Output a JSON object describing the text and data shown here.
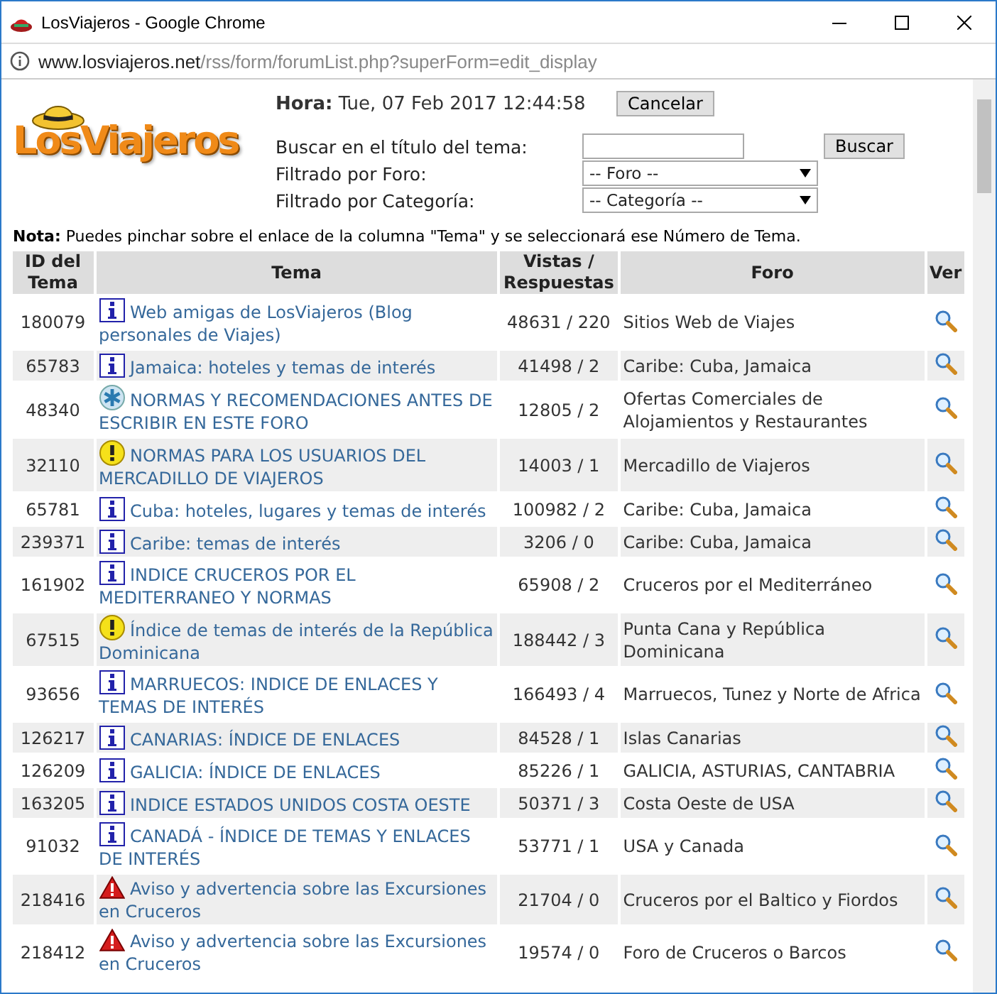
{
  "window": {
    "title": "LosViajeros - Google Chrome"
  },
  "address_bar": {
    "domain": "www.losviajeros.net",
    "path": "/rss/form/forumList.php?superForm=edit_display"
  },
  "logo": {
    "text": "LosViajeros"
  },
  "time": {
    "label": "Hora:",
    "value": "Tue, 07 Feb 2017 12:44:58"
  },
  "cancel_button": "Cancelar",
  "search": {
    "label": "Buscar en el título del tema:",
    "button": "Buscar"
  },
  "filters": [
    {
      "label": "Filtrado por Foro:",
      "value": "-- Foro --"
    },
    {
      "label": "Filtrado por Categoría:",
      "value": "-- Categoría --"
    }
  ],
  "note": "**Nota:** Puedes pinchar sobre el enlace de la columna \"Tema\" y se seleccionará ese Número de Tema.",
  "table": {
    "columns": [
      "ID del Tema",
      "Tema",
      "Vistas / Respuestas",
      "Foro",
      "Ver"
    ],
    "rows": [
      {
        "id": "180079",
        "kind": "info",
        "topic": "Web amigas de LosViajeros (Blog personales de Viajes)",
        "views": "48631 / 220",
        "forum": "Sitios Web de Viajes"
      },
      {
        "id": "65783",
        "kind": "info",
        "topic": "Jamaica: hoteles y temas de interés",
        "views": "41498 / 2",
        "forum": "Caribe: Cuba, Jamaica"
      },
      {
        "id": "48340",
        "kind": "asterisk",
        "topic": "NORMAS Y RECOMENDACIONES ANTES DE ESCRIBIR EN ESTE FORO",
        "views": "12805 / 2",
        "forum": "Ofertas Comerciales de Alojamientos y Restaurantes"
      },
      {
        "id": "32110",
        "kind": "notice",
        "topic": "NORMAS PARA LOS USUARIOS DEL MERCADILLO DE VIAJEROS",
        "views": "14003 / 1",
        "forum": "Mercadillo de Viajeros"
      },
      {
        "id": "65781",
        "kind": "info",
        "topic": "Cuba: hoteles, lugares y temas de interés",
        "views": "100982 / 2",
        "forum": "Caribe: Cuba, Jamaica"
      },
      {
        "id": "239371",
        "kind": "info",
        "topic": "Caribe: temas de interés",
        "views": "3206 / 0",
        "forum": "Caribe: Cuba, Jamaica"
      },
      {
        "id": "161902",
        "kind": "info",
        "topic": "INDICE CRUCEROS POR EL MEDITERRANEO Y NORMAS",
        "views": "65908 / 2",
        "forum": "Cruceros por el Mediterráneo"
      },
      {
        "id": "67515",
        "kind": "notice",
        "topic": "Índice de temas de interés de la República Dominicana",
        "views": "188442 / 3",
        "forum": "Punta Cana y República Dominicana"
      },
      {
        "id": "93656",
        "kind": "info",
        "topic": "MARRUECOS: INDICE DE ENLACES Y TEMAS DE INTERÉS",
        "views": "166493 / 4",
        "forum": "Marruecos, Tunez y Norte de Africa"
      },
      {
        "id": "126217",
        "kind": "info",
        "topic": "CANARIAS: ÍNDICE DE ENLACES",
        "views": "84528 / 1",
        "forum": "Islas Canarias"
      },
      {
        "id": "126209",
        "kind": "info",
        "topic": "GALICIA: ÍNDICE DE ENLACES",
        "views": "85226 / 1",
        "forum": "GALICIA, ASTURIAS, CANTABRIA"
      },
      {
        "id": "163205",
        "kind": "info",
        "topic": "INDICE ESTADOS UNIDOS COSTA OESTE",
        "views": "50371 / 3",
        "forum": "Costa Oeste de USA"
      },
      {
        "id": "91032",
        "kind": "info",
        "topic": "CANADÁ - ÍNDICE DE TEMAS Y ENLACES DE INTERÉS",
        "views": "53771 / 1",
        "forum": "USA y Canada"
      },
      {
        "id": "218416",
        "kind": "warning",
        "topic": "Aviso y advertencia sobre las Excursiones en Cruceros",
        "views": "21704 / 0",
        "forum": "Cruceros por el Baltico y Fiordos"
      },
      {
        "id": "218412",
        "kind": "warning",
        "topic": "Aviso y advertencia sobre las Excursiones en Cruceros",
        "views": "19574 / 0",
        "forum": "Foro de Cruceros o Barcos"
      }
    ]
  }
}
